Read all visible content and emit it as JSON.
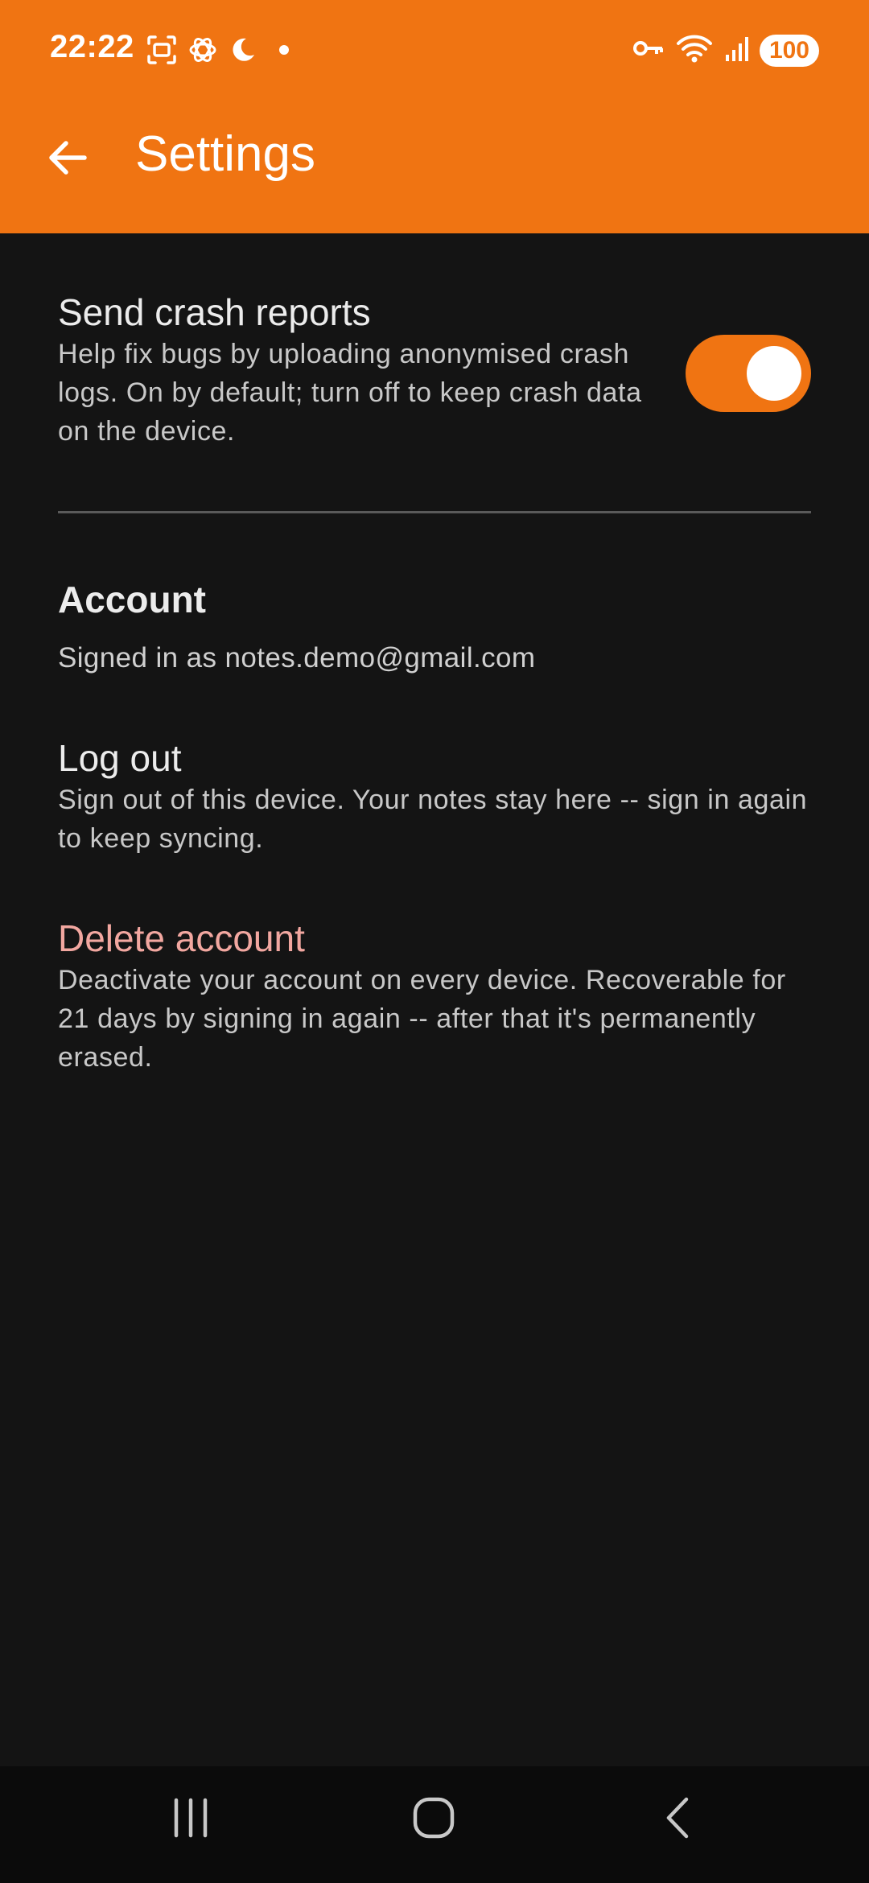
{
  "status_bar": {
    "time": "22:22",
    "battery": "100",
    "icons_left": [
      "screenshot-icon",
      "chatgpt-icon",
      "moon-icon",
      "dot-icon"
    ],
    "icons_right": [
      "key-icon",
      "wifi-icon",
      "signal-icon",
      "battery-icon"
    ]
  },
  "toolbar": {
    "title": "Settings",
    "back_icon": "arrow-left-icon"
  },
  "crash_reports": {
    "title": "Send crash reports",
    "description": "Help fix bugs by uploading anonymised crash logs. On by default; turn off to keep crash data on the device.",
    "enabled": true
  },
  "account": {
    "header": "Account",
    "signed_in_text": "Signed in as notes.demo@gmail.com"
  },
  "logout": {
    "title": "Log out",
    "description": "Sign out of this device. Your notes stay here -- sign in again to keep syncing."
  },
  "delete_account": {
    "title": "Delete account",
    "description": "Deactivate your account on every device. Recoverable for 21 days by signing in again -- after that it's permanently erased."
  },
  "nav_bar": {
    "icons": [
      "recents-icon",
      "home-icon",
      "back-icon"
    ]
  },
  "colors": {
    "accent": "#F07412",
    "background": "#141414",
    "danger_text": "#F2A7A0",
    "nav_background": "#0b0b0b"
  }
}
